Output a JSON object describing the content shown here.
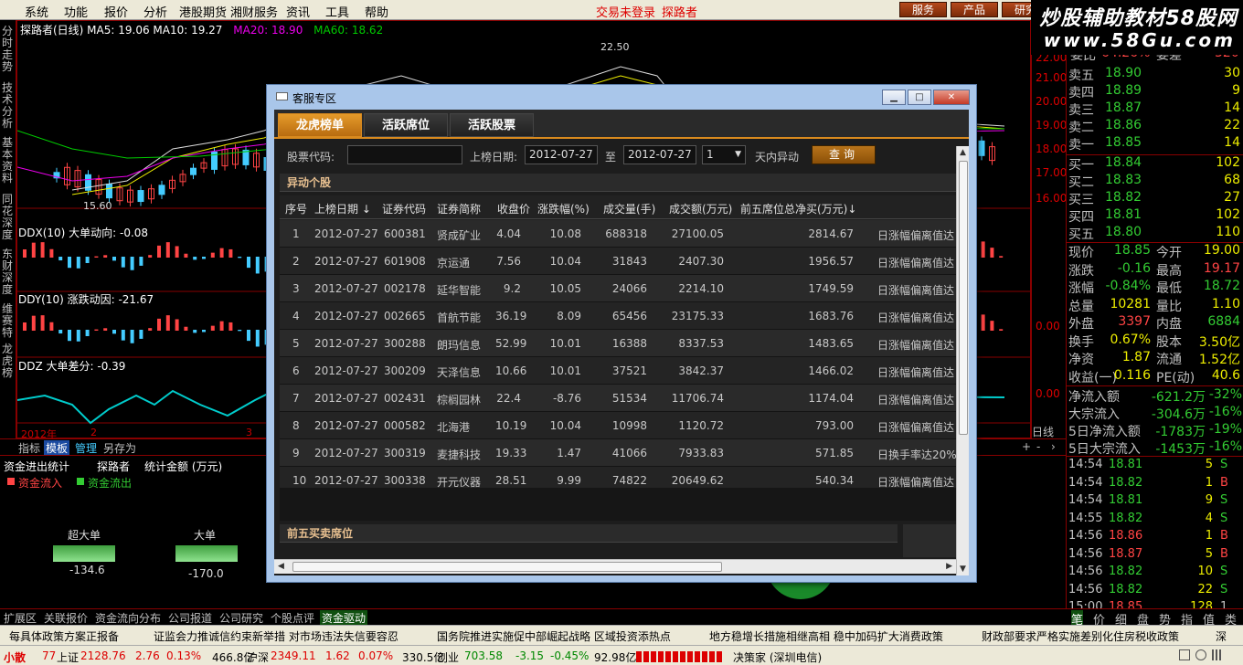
{
  "menu": {
    "items": [
      "系统",
      "功能",
      "报价",
      "分析",
      "港股期货",
      "湘财服务",
      "资讯",
      "工具",
      "帮助"
    ],
    "trade_login": "交易未登录",
    "explorer": "探路者",
    "buttons": [
      "服务",
      "产品",
      "研究"
    ]
  },
  "brand": {
    "line1": "炒股辅助教材58股网",
    "line2": "www.58Gu.com"
  },
  "left_tabs": [
    "分时走势",
    "技术分析",
    "基本资料",
    "同花深度",
    "东财深度",
    "维赛特",
    "龙虎榜"
  ],
  "chart": {
    "header": "探路者(日线) MA5: 19.06  MA10: 19.27",
    "ma20": "MA20: 18.90",
    "ma60": "MA60: 18.62",
    "high_label": "22.50",
    "low_label": "15.60",
    "ddx": "DDX(10) 大单动向: -0.08",
    "ddy": "DDY(10) 涨跌动因: -21.67",
    "ddz": "DDZ 大单差分: -0.39",
    "year_label": "2012年",
    "m2": "2",
    "m3": "3",
    "period": "日线",
    "scale": [
      "22.00",
      "21.00",
      "20.00",
      "19.00",
      "18.00",
      "17.00",
      "16.00",
      "0.00",
      "0.00"
    ]
  },
  "bottom_tabs": [
    "指标",
    "模板",
    "管理",
    "另存为"
  ],
  "money": {
    "title": "资金进出统计",
    "stock": "探路者",
    "metric": "统计金额 (万元)",
    "legend_in": "资金流入",
    "legend_out": "资金流出",
    "cats": [
      {
        "label": "超大单",
        "value": "-134.6"
      },
      {
        "label": "大单",
        "value": "-170.0"
      }
    ]
  },
  "taskbar": [
    "扩展区",
    "关联报价",
    "资金流向分布",
    "公司报道",
    "公司研究",
    "个股点评",
    "资金驱动"
  ],
  "quote": {
    "partial_top": {
      "label": "委比",
      "value": "64.26%",
      "label2": "委差",
      "value2": "320"
    },
    "asks": [
      {
        "l": "卖五",
        "p": "18.90",
        "v": "30"
      },
      {
        "l": "卖四",
        "p": "18.89",
        "v": "9"
      },
      {
        "l": "卖三",
        "p": "18.87",
        "v": "14"
      },
      {
        "l": "卖二",
        "p": "18.86",
        "v": "22"
      },
      {
        "l": "卖一",
        "p": "18.85",
        "v": "14"
      }
    ],
    "bids": [
      {
        "l": "买一",
        "p": "18.84",
        "v": "102"
      },
      {
        "l": "买二",
        "p": "18.83",
        "v": "68"
      },
      {
        "l": "买三",
        "p": "18.82",
        "v": "27"
      },
      {
        "l": "买四",
        "p": "18.81",
        "v": "102"
      },
      {
        "l": "买五",
        "p": "18.80",
        "v": "110"
      }
    ],
    "stats": [
      {
        "l1": "现价",
        "v1": "18.85",
        "l2": "今开",
        "v2": "19.00"
      },
      {
        "l1": "涨跌",
        "v1": "-0.16",
        "l2": "最高",
        "v2": "19.17"
      },
      {
        "l1": "涨幅",
        "v1": "-0.84%",
        "l2": "最低",
        "v2": "18.72"
      },
      {
        "l1": "总量",
        "v1": "10281",
        "l2": "量比",
        "v2": "1.10"
      },
      {
        "l1": "外盘",
        "v1": "3397",
        "l2": "内盘",
        "v2": "6884"
      },
      {
        "l1": "换手",
        "v1": "0.67%",
        "l2": "股本",
        "v2": "3.50亿"
      },
      {
        "l1": "净资",
        "v1": "1.87",
        "l2": "流通",
        "v2": "1.52亿"
      },
      {
        "l1": "收益(一)",
        "v1": "0.116",
        "l2": "PE(动)",
        "v2": "40.6"
      }
    ],
    "flows": [
      {
        "l": "净流入额",
        "v": "-621.2万",
        "p": "-32%"
      },
      {
        "l": "大宗流入",
        "v": "-304.6万",
        "p": "-16%"
      },
      {
        "l": "5日净流入额",
        "v": "-1783万",
        "p": "-19%"
      },
      {
        "l": "5日大宗流入",
        "v": "-1453万",
        "p": "-16%"
      }
    ],
    "ticks": [
      {
        "t": "14:54",
        "p": "18.81",
        "v": "5",
        "s": "S"
      },
      {
        "t": "14:54",
        "p": "18.82",
        "v": "1",
        "s": "B"
      },
      {
        "t": "14:54",
        "p": "18.81",
        "v": "9",
        "s": "S"
      },
      {
        "t": "14:55",
        "p": "18.82",
        "v": "4",
        "s": "S"
      },
      {
        "t": "14:56",
        "p": "18.86",
        "v": "1",
        "s": "B"
      },
      {
        "t": "14:56",
        "p": "18.87",
        "v": "5",
        "s": "B"
      },
      {
        "t": "14:56",
        "p": "18.82",
        "v": "10",
        "s": "S"
      },
      {
        "t": "14:56",
        "p": "18.82",
        "v": "22",
        "s": "S"
      },
      {
        "t": "15:00",
        "p": "18.85",
        "v": "128",
        "s": "1"
      }
    ],
    "tabs": [
      "笔",
      "价",
      "细",
      "盘",
      "势",
      "指",
      "值",
      "类"
    ]
  },
  "news": [
    "每具体政策方案正报备",
    "证监会力推诚信约束新举措 对市场违法失信要容忍",
    "国务院推进实施促中部崛起战略 区域投资添热点",
    "地方稳增长措施相继高相 稳中加码扩大消费政策",
    "财政部要求严格实施差别化住房税收政策",
    "深"
  ],
  "status": {
    "sh_label": "上证",
    "sh_val": "2128.76",
    "sh_chg": "2.76",
    "sh_pct": "0.13%",
    "sh_amt": "466.8亿",
    "sz_label": "沪深",
    "sz_val": "2349.11",
    "sz_chg": "1.62",
    "sz_pct": "0.07%",
    "sz_amt": "330.5亿",
    "cy_label": "创业",
    "cy_val": "703.58",
    "cy_chg": "-3.15",
    "cy_pct": "-0.45%",
    "cy_amt": "92.98亿",
    "left_logo": "小散",
    "left_num": "77",
    "server": "决策家 (深圳电信)"
  },
  "dialog": {
    "title": "客服专区",
    "tabs": [
      "龙虎榜单",
      "活跃席位",
      "活跃股票"
    ],
    "form": {
      "code_label": "股票代码:",
      "code_value": "",
      "date_label": "上榜日期:",
      "date_from": "2012-07-27",
      "to": "至",
      "date_to": "2012-07-27",
      "days": "1",
      "days_suffix": "天内异动",
      "query": "查询"
    },
    "section1": "异动个股",
    "section2": "前五买卖席位",
    "columns": [
      "序号",
      "上榜日期 ↓",
      "证券代码",
      "证券简称",
      "收盘价",
      "涨跌幅(%)",
      "成交量(手)",
      "成交额(万元)",
      "前五席位总净买(万元)↓"
    ],
    "rows": [
      {
        "n": "1",
        "d": "2012-07-27",
        "c": "600381",
        "s": "贤成矿业",
        "cl": "4.04",
        "pct": "10.08",
        "vol": "688318",
        "amt": "27100.05",
        "net": "2814.67",
        "r": "日涨幅偏离值达"
      },
      {
        "n": "2",
        "d": "2012-07-27",
        "c": "601908",
        "s": "京运通",
        "cl": "7.56",
        "pct": "10.04",
        "vol": "31843",
        "amt": "2407.30",
        "net": "1956.57",
        "r": "日涨幅偏离值达"
      },
      {
        "n": "3",
        "d": "2012-07-27",
        "c": "002178",
        "s": "延华智能",
        "cl": "9.2",
        "pct": "10.05",
        "vol": "24066",
        "amt": "2214.10",
        "net": "1749.59",
        "r": "日涨幅偏离值达"
      },
      {
        "n": "4",
        "d": "2012-07-27",
        "c": "002665",
        "s": "首航节能",
        "cl": "36.19",
        "pct": "8.09",
        "vol": "65456",
        "amt": "23175.33",
        "net": "1683.76",
        "r": "日涨幅偏离值达"
      },
      {
        "n": "5",
        "d": "2012-07-27",
        "c": "300288",
        "s": "朗玛信息",
        "cl": "52.99",
        "pct": "10.01",
        "vol": "16388",
        "amt": "8337.53",
        "net": "1483.65",
        "r": "日涨幅偏离值达"
      },
      {
        "n": "6",
        "d": "2012-07-27",
        "c": "300209",
        "s": "天泽信息",
        "cl": "10.66",
        "pct": "10.01",
        "vol": "37521",
        "amt": "3842.37",
        "net": "1466.02",
        "r": "日涨幅偏离值达"
      },
      {
        "n": "7",
        "d": "2012-07-27",
        "c": "002431",
        "s": "棕榈园林",
        "cl": "22.4",
        "pct": "-8.76",
        "vol": "51534",
        "amt": "11706.74",
        "net": "1174.04",
        "r": "日涨幅偏离值达"
      },
      {
        "n": "8",
        "d": "2012-07-27",
        "c": "000582",
        "s": "北海港",
        "cl": "10.19",
        "pct": "10.04",
        "vol": "10998",
        "amt": "1120.72",
        "net": "793.00",
        "r": "日涨幅偏离值达"
      },
      {
        "n": "9",
        "d": "2012-07-27",
        "c": "300319",
        "s": "麦捷科技",
        "cl": "19.33",
        "pct": "1.47",
        "vol": "41066",
        "amt": "7933.83",
        "net": "571.85",
        "r": "日换手率达20%"
      },
      {
        "n": "10",
        "d": "2012-07-27",
        "c": "300338",
        "s": "开元仪器",
        "cl": "28.51",
        "pct": "9.99",
        "vol": "74822",
        "amt": "20649.62",
        "net": "540.34",
        "r": "日涨幅偏离值达"
      }
    ]
  }
}
